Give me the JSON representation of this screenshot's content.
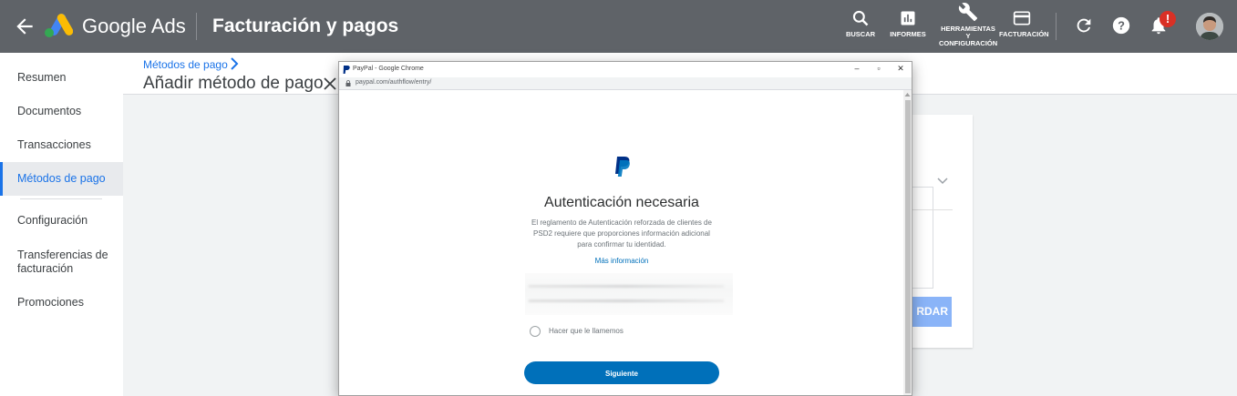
{
  "topbar": {
    "brand": "Google Ads",
    "title": "Facturación y pagos",
    "tools": {
      "search": "BUSCAR",
      "reports": "INFORMES",
      "tools_l1": "HERRAMIENTAS",
      "tools_l2": "Y",
      "tools_l3": "CONFIGURACIÓN",
      "billing": "FACTURACIÓN"
    },
    "notification_badge": "!"
  },
  "sidebar": {
    "items": [
      {
        "label": "Resumen"
      },
      {
        "label": "Documentos"
      },
      {
        "label": "Transacciones"
      },
      {
        "label": "Métodos de pago"
      },
      {
        "label": "Configuración"
      },
      {
        "label": "Transferencias de facturación"
      },
      {
        "label": "Promociones"
      }
    ]
  },
  "main": {
    "breadcrumb": "Métodos de pago",
    "subtitle": "Añadir método de pago",
    "background_button": "RDAR"
  },
  "popup": {
    "window_title": "PayPal - Google Chrome",
    "url": "paypal.com/authflow/entry/",
    "heading": "Autenticación necesaria",
    "body": "El reglamento de Autenticación reforzada de clientes de PSD2 requiere que proporciones información adicional para confirmar tu identidad.",
    "link": "Más información",
    "radio_label": "Hacer que le llamemos",
    "next_button": "Siguiente"
  },
  "colors": {
    "topbar": "#5f6368",
    "accent": "#1a73e8",
    "paypal_blue": "#0070ba",
    "paypal_dark": "#003087",
    "notification": "#d93025"
  },
  "icons": {
    "back": "arrow-left-icon",
    "search": "search-icon",
    "reports": "bar-chart-icon",
    "tools": "wrench-icon",
    "billing": "credit-card-icon",
    "refresh": "refresh-icon",
    "help": "help-icon",
    "notifications": "bell-icon"
  }
}
